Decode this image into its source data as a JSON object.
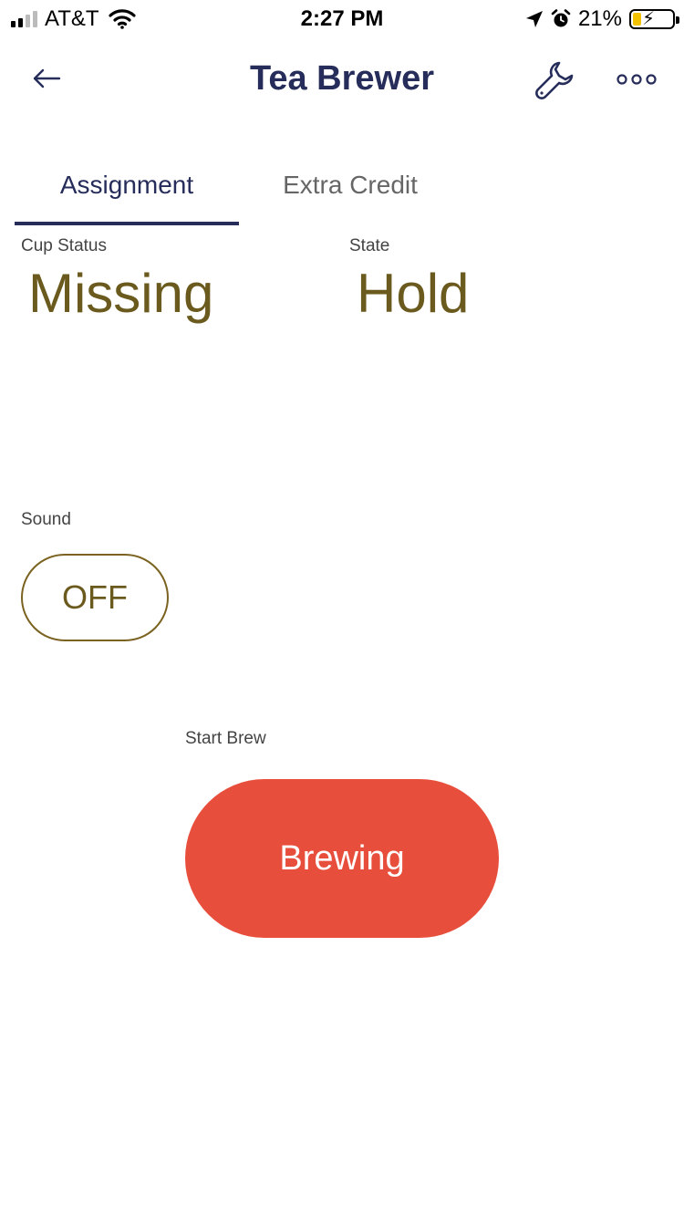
{
  "status_bar": {
    "carrier": "AT&T",
    "time": "2:27 PM",
    "battery_percent": "21%",
    "battery_level": 0.21,
    "signal_bars_filled": 2,
    "signal_bars_total": 4,
    "icons": [
      "signal-icon",
      "wifi-icon",
      "location-arrow-icon",
      "alarm-icon",
      "battery-charging-icon"
    ]
  },
  "header": {
    "title": "Tea Brewer",
    "back_icon": "arrow-left-icon",
    "settings_icon": "wrench-icon",
    "more_icon": "more-dots-icon"
  },
  "tabs": [
    {
      "label": "Assignment",
      "active": true
    },
    {
      "label": "Extra Credit",
      "active": false
    }
  ],
  "cup_status": {
    "label": "Cup Status",
    "value": "Missing"
  },
  "state": {
    "label": "State",
    "value": "Hold"
  },
  "sound": {
    "label": "Sound",
    "value": "OFF"
  },
  "start_brew": {
    "label": "Start Brew",
    "button_label": "Brewing"
  },
  "colors": {
    "accent_navy": "#262d5a",
    "value_olive": "#6b5a1e",
    "brew_button": "#e84e3c",
    "battery_fill": "#f2c200"
  }
}
